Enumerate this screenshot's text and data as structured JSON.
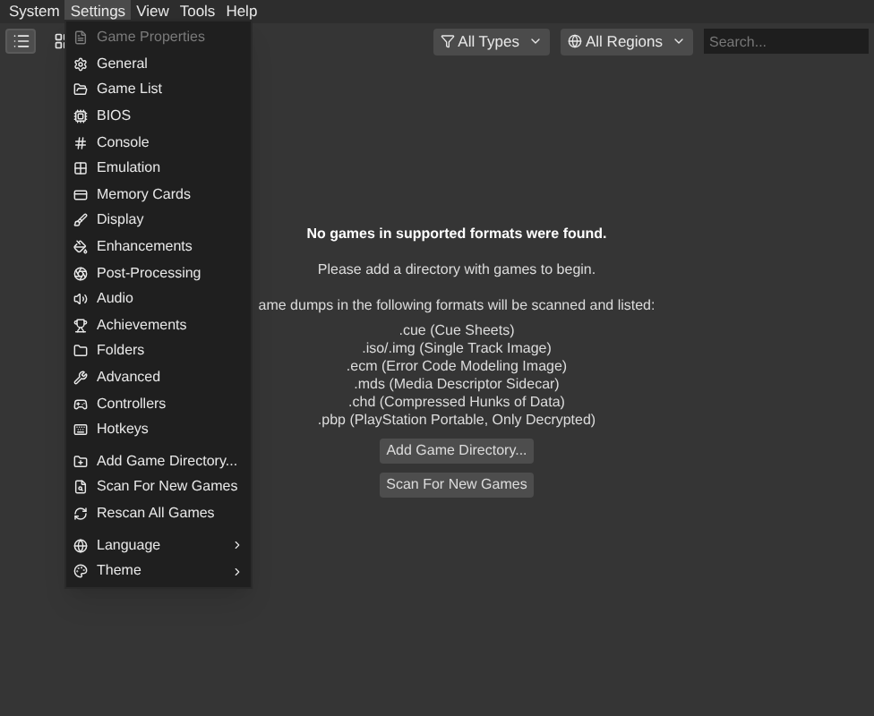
{
  "menubar": [
    {
      "label": "System",
      "selected": false
    },
    {
      "label": "Settings",
      "selected": true
    },
    {
      "label": "View",
      "selected": false
    },
    {
      "label": "Tools",
      "selected": false
    },
    {
      "label": "Help",
      "selected": false
    }
  ],
  "toolbar": {
    "view_buttons": [
      {
        "kind": "list",
        "selected": true
      },
      {
        "kind": "grid",
        "selected": false
      }
    ],
    "type_filter": "All Types",
    "region_filter": "All Regions",
    "search": {
      "placeholder": "Search..."
    }
  },
  "menu": [
    {
      "kind": "item",
      "label": "Game Properties",
      "disabled": true,
      "submenu": false
    },
    {
      "kind": "item",
      "label": "General",
      "disabled": false,
      "submenu": false
    },
    {
      "kind": "item",
      "label": "Game List",
      "disabled": false,
      "submenu": false
    },
    {
      "kind": "item",
      "label": "BIOS",
      "disabled": false,
      "submenu": false
    },
    {
      "kind": "item",
      "label": "Console",
      "disabled": false,
      "submenu": false
    },
    {
      "kind": "item",
      "label": "Emulation",
      "disabled": false,
      "submenu": false
    },
    {
      "kind": "item",
      "label": "Memory Cards",
      "disabled": false,
      "submenu": false
    },
    {
      "kind": "item",
      "label": "Display",
      "disabled": false,
      "submenu": false
    },
    {
      "kind": "item",
      "label": "Enhancements",
      "disabled": false,
      "submenu": false
    },
    {
      "kind": "item",
      "label": "Post-Processing",
      "disabled": false,
      "submenu": false
    },
    {
      "kind": "item",
      "label": "Audio",
      "disabled": false,
      "submenu": false
    },
    {
      "kind": "item",
      "label": "Achievements",
      "disabled": false,
      "submenu": false
    },
    {
      "kind": "item",
      "label": "Folders",
      "disabled": false,
      "submenu": false
    },
    {
      "kind": "item",
      "label": "Advanced",
      "disabled": false,
      "submenu": false
    },
    {
      "kind": "item",
      "label": "Controllers",
      "disabled": false,
      "submenu": false
    },
    {
      "kind": "item",
      "label": "Hotkeys",
      "disabled": false,
      "submenu": false
    },
    {
      "kind": "separator"
    },
    {
      "kind": "item",
      "label": "Add Game Directory...",
      "disabled": false,
      "submenu": false
    },
    {
      "kind": "item",
      "label": "Scan For New Games",
      "disabled": false,
      "submenu": false
    },
    {
      "kind": "item",
      "label": "Rescan All Games",
      "disabled": false,
      "submenu": false
    },
    {
      "kind": "separator"
    },
    {
      "kind": "item",
      "label": "Language",
      "disabled": false,
      "submenu": true
    },
    {
      "kind": "item",
      "label": "Theme",
      "disabled": false,
      "submenu": true
    }
  ],
  "empty_state": {
    "title": "No games in supported formats were found.",
    "hint": "Please add a directory with games to begin.",
    "formats_intro": "ame dumps in the following formats will be scanned and listed:",
    "formats": [
      ".cue (Cue Sheets)",
      ".iso/.img (Single Track Image)",
      ".ecm (Error Code Modeling Image)",
      ".mds (Media Descriptor Sidecar)",
      ".chd (Compressed Hunks of Data)",
      ".pbp (PlayStation Portable, Only Decrypted)"
    ],
    "buttons": [
      "Add Game Directory...",
      "Scan For New Games"
    ]
  }
}
